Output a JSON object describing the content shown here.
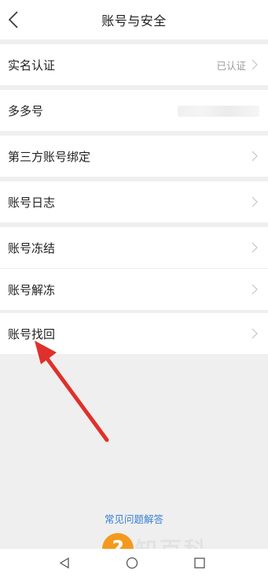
{
  "header": {
    "title": "账号与安全"
  },
  "rows": [
    {
      "label": "实名认证",
      "value": "已认证"
    },
    {
      "label": "多多号",
      "value": ""
    },
    {
      "label": "第三方账号绑定",
      "value": ""
    },
    {
      "label": "账号日志",
      "value": ""
    },
    {
      "label": "账号冻结",
      "value": ""
    },
    {
      "label": "账号解冻",
      "value": ""
    },
    {
      "label": "账号找回",
      "value": ""
    }
  ],
  "faq": {
    "label": "常见问题解答"
  },
  "watermark": {
    "text": "知百科"
  },
  "colors": {
    "accent": "#3a7fd5",
    "annotation": "#e0302b",
    "background": "#efefef"
  },
  "icons": {
    "back": "chevron-left-icon",
    "row_arrow": "chevron-right-icon",
    "nav_back": "triangle-back-icon",
    "nav_home": "circle-home-icon",
    "nav_recents": "square-recents-icon"
  }
}
